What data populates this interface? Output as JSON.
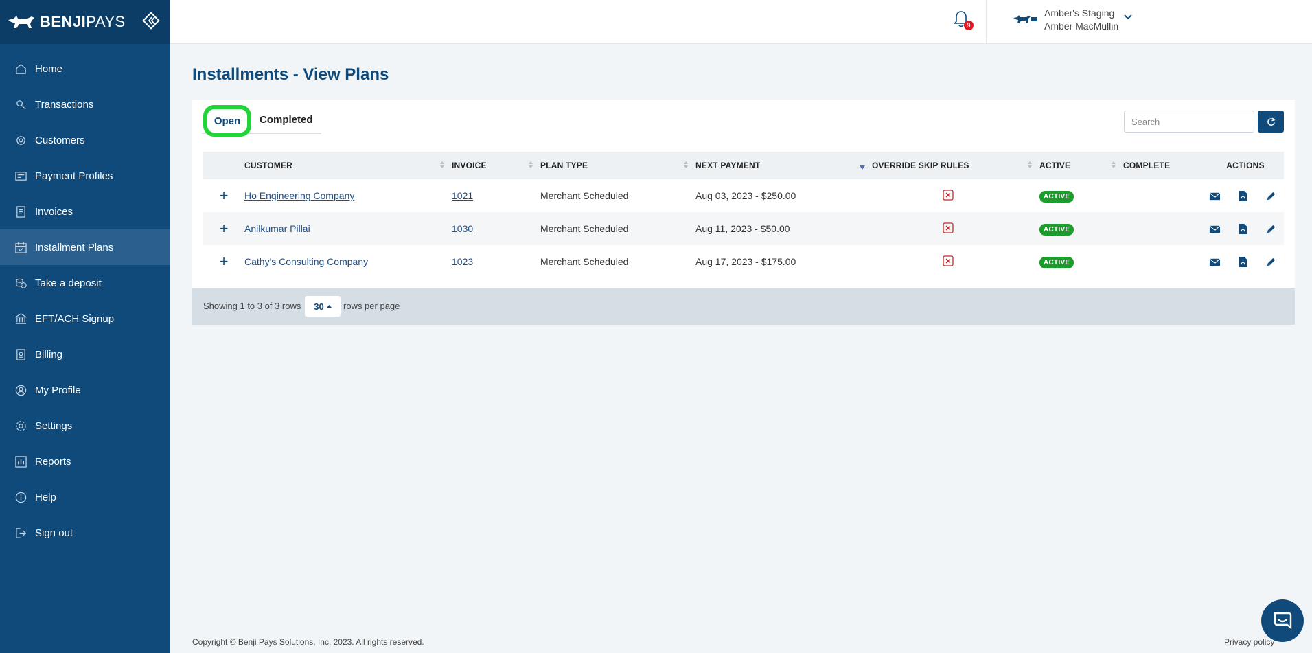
{
  "brand": {
    "bold": "BENJI",
    "light": "PAYS"
  },
  "sidebar": {
    "items": [
      {
        "label": "Home",
        "icon": "home-icon"
      },
      {
        "label": "Transactions",
        "icon": "transactions-icon"
      },
      {
        "label": "Customers",
        "icon": "customers-icon"
      },
      {
        "label": "Payment Profiles",
        "icon": "payment-profiles-icon"
      },
      {
        "label": "Invoices",
        "icon": "invoices-icon"
      },
      {
        "label": "Installment Plans",
        "icon": "calendar-icon",
        "active": true
      },
      {
        "label": "Take a deposit",
        "icon": "coins-icon"
      },
      {
        "label": "EFT/ACH Signup",
        "icon": "bank-icon"
      },
      {
        "label": "Billing",
        "icon": "billing-icon"
      },
      {
        "label": "My Profile",
        "icon": "profile-icon"
      },
      {
        "label": "Settings",
        "icon": "gear-icon"
      },
      {
        "label": "Reports",
        "icon": "reports-icon"
      },
      {
        "label": "Help",
        "icon": "info-icon"
      },
      {
        "label": "Sign out",
        "icon": "sign-out-icon"
      }
    ]
  },
  "header": {
    "notification_count": "9",
    "account_name": "Amber's Staging",
    "user_name": "Amber MacMullin"
  },
  "page": {
    "title": "Installments - View Plans",
    "tabs": {
      "open": "Open",
      "completed": "Completed"
    },
    "search_placeholder": "Search"
  },
  "table": {
    "columns": [
      "CUSTOMER",
      "INVOICE",
      "PLAN TYPE",
      "NEXT PAYMENT",
      "OVERRIDE SKIP RULES",
      "ACTIVE",
      "COMPLETE",
      "ACTIONS"
    ],
    "rows": [
      {
        "customer": "Ho Engineering Company",
        "invoice": "1021",
        "plan_type": "Merchant Scheduled",
        "next_payment": "Aug 03, 2023 - $250.00",
        "active": "ACTIVE"
      },
      {
        "customer": "Anilkumar Pillai",
        "invoice": "1030",
        "plan_type": "Merchant Scheduled",
        "next_payment": "Aug 11, 2023 - $50.00",
        "active": "ACTIVE"
      },
      {
        "customer": "Cathy's Consulting Company",
        "invoice": "1023",
        "plan_type": "Merchant Scheduled",
        "next_payment": "Aug 17, 2023 - $175.00",
        "active": "ACTIVE"
      }
    ]
  },
  "pagination": {
    "showing": "Showing 1 to 3 of 3 rows",
    "per_page": "30",
    "rows_per_page": "rows per page"
  },
  "footer": {
    "copyright": "Copyright © Benji Pays Solutions, Inc. 2023. All rights reserved.",
    "privacy": "Privacy policy"
  },
  "colors": {
    "sidebar": "#0f4a7b",
    "sidebar_active": "#2b5f8d",
    "tab_highlight": "#22d43a",
    "badge_active": "#1a9d2a",
    "x_icon": "#c62828"
  }
}
